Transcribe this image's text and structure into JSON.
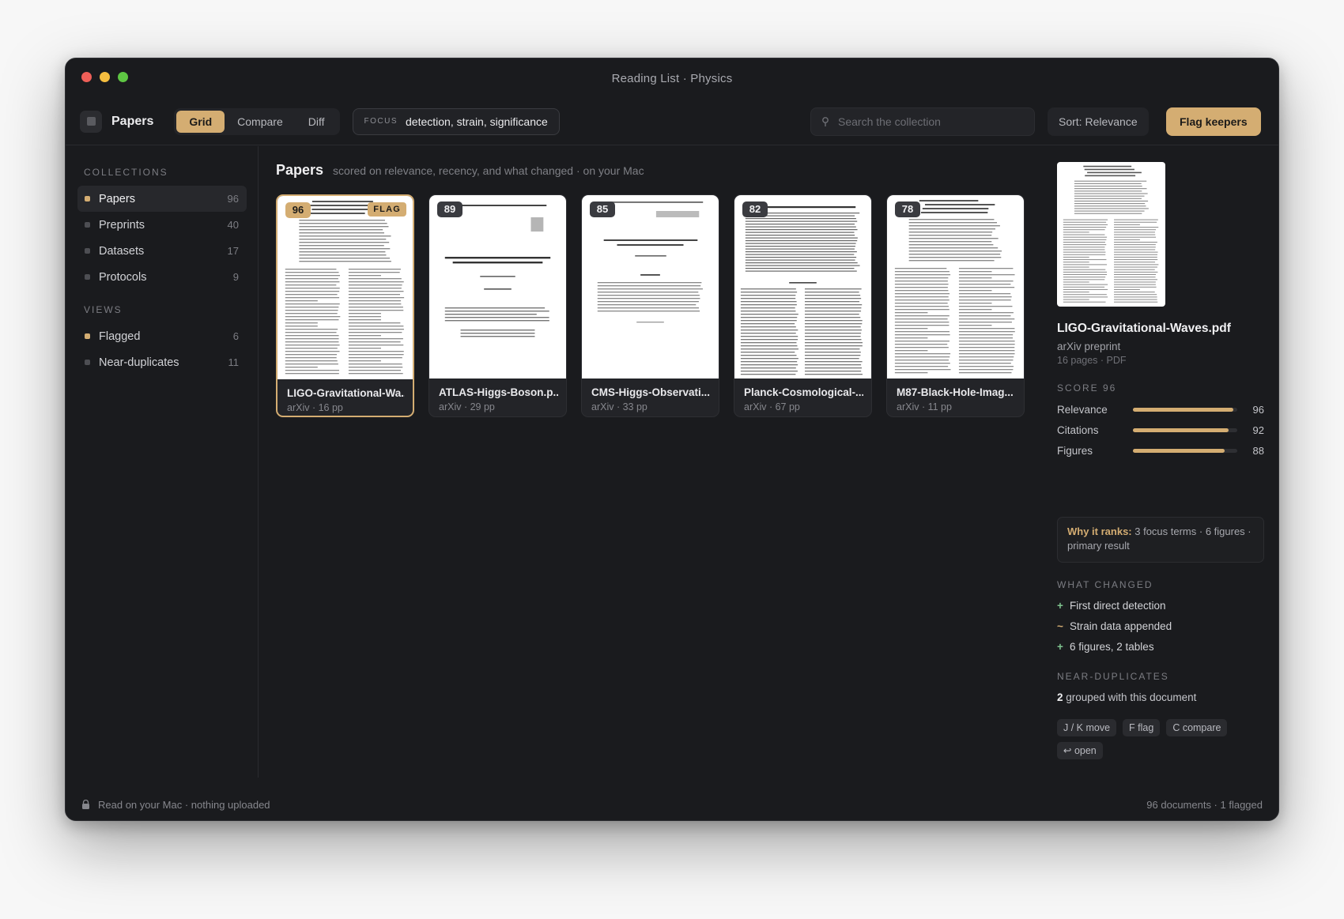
{
  "window": {
    "title": "Reading List · Physics"
  },
  "toolbar": {
    "app_name": "Papers",
    "view_tabs": [
      {
        "label": "Grid",
        "active": true
      },
      {
        "label": "Compare",
        "active": false
      },
      {
        "label": "Diff",
        "active": false
      }
    ],
    "focus_label": "FOCUS",
    "focus_value": "detection, strain, significance",
    "search_placeholder": "Search the collection",
    "sort_label": "Sort: Relevance",
    "flag_button": "Flag keepers"
  },
  "sidebar": {
    "collections_title": "COLLECTIONS",
    "collections": [
      {
        "label": "Papers",
        "count": "96",
        "active": true
      },
      {
        "label": "Preprints",
        "count": "40"
      },
      {
        "label": "Datasets",
        "count": "17"
      },
      {
        "label": "Protocols",
        "count": "9"
      }
    ],
    "views_title": "VIEWS",
    "views": [
      {
        "label": "Flagged",
        "count": "6"
      },
      {
        "label": "Near-duplicates",
        "count": "11"
      }
    ]
  },
  "main": {
    "heading": "Papers",
    "subheading": "scored on relevance, recency, and what changed · on your Mac",
    "cards": [
      {
        "score": "96",
        "flag": "FLAG",
        "name": "LIGO-Gravitational-Wa...",
        "info": "arXiv · 16 pp",
        "selected": true
      },
      {
        "score": "89",
        "name": "ATLAS-Higgs-Boson.p...",
        "info": "arXiv · 29 pp"
      },
      {
        "score": "85",
        "name": "CMS-Higgs-Observati...",
        "info": "arXiv · 33 pp"
      },
      {
        "score": "82",
        "name": "Planck-Cosmological-...",
        "info": "arXiv · 67 pp"
      },
      {
        "score": "78",
        "name": "M87-Black-Hole-Imag...",
        "info": "arXiv · 11 pp"
      }
    ]
  },
  "inspector": {
    "filename": "LIGO-Gravitational-Waves.pdf",
    "type": "arXiv preprint",
    "pages": "16 pages · PDF",
    "score_title": "SCORE 96",
    "metrics": [
      {
        "label": "Relevance",
        "value": 96
      },
      {
        "label": "Citations",
        "value": 92
      },
      {
        "label": "Figures",
        "value": 88
      }
    ],
    "why_label": "Why it ranks:",
    "why_text": " 3 focus terms · 6 figures · primary result",
    "changed_title": "WHAT CHANGED",
    "changes": [
      {
        "symbol": "+",
        "kind": "plus",
        "text": "First direct detection"
      },
      {
        "symbol": "~",
        "kind": "tilde",
        "text": "Strain data appended"
      },
      {
        "symbol": "+",
        "kind": "plus",
        "text": "6 figures, 2 tables"
      }
    ],
    "dups_title": "NEAR-DUPLICATES",
    "dups_count": "2",
    "dups_text": " grouped with this document",
    "shortcuts": [
      "J / K move",
      "F flag",
      "C compare",
      "↩ open"
    ]
  },
  "status": {
    "left": "Read on your Mac · nothing uploaded",
    "right": "96 documents · 1 flagged"
  },
  "colors": {
    "accent": "#d4ad72",
    "window_bg": "#1a1b1e",
    "added": "#7fc48f"
  }
}
